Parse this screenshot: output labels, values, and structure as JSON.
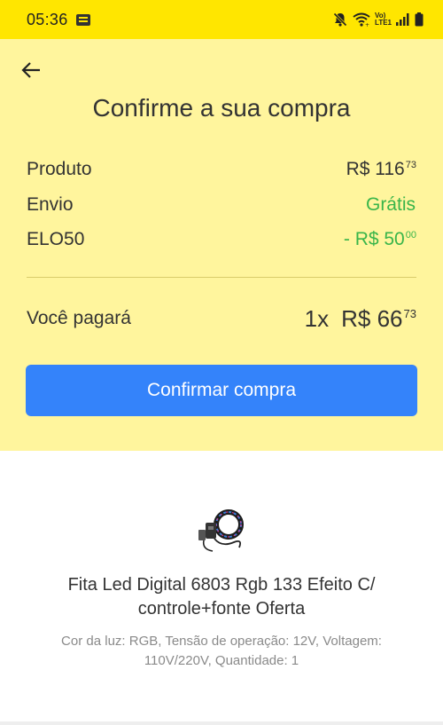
{
  "status_bar": {
    "time": "05:36",
    "network_label_top": "Vo)",
    "network_label_bottom": "LTE1"
  },
  "header": {
    "title": "Confirme a sua compra"
  },
  "summary": {
    "rows": [
      {
        "label": "Produto",
        "value": "R$ 116",
        "cents": "73",
        "color": "#333333"
      },
      {
        "label": "Envio",
        "value": "Grátis",
        "cents": "",
        "color": "#39b54a"
      },
      {
        "label": "ELO50",
        "value": "- R$ 50",
        "cents": "00",
        "color": "#39b54a"
      }
    ]
  },
  "total": {
    "label": "Você pagará",
    "quantity": "1x",
    "value": "R$ 66",
    "cents": "73"
  },
  "confirm_button": {
    "label": "Confirmar compra"
  },
  "product": {
    "title": "Fita Led Digital 6803 Rgb 133 Efeito C/ controle+fonte Oferta",
    "attributes": "Cor da luz: RGB, Tensão de operação: 12V, Voltagem: 110V/220V, Quantidade: 1"
  },
  "colors": {
    "brand_yellow": "#ffe600",
    "panel_yellow": "#fff59d",
    "primary_blue": "#3483fa",
    "discount_green": "#39b54a"
  },
  "icons": {
    "back": "arrow-left-icon",
    "mute": "mute-icon",
    "wifi": "wifi-icon",
    "signal": "signal-icon",
    "battery": "battery-icon"
  }
}
